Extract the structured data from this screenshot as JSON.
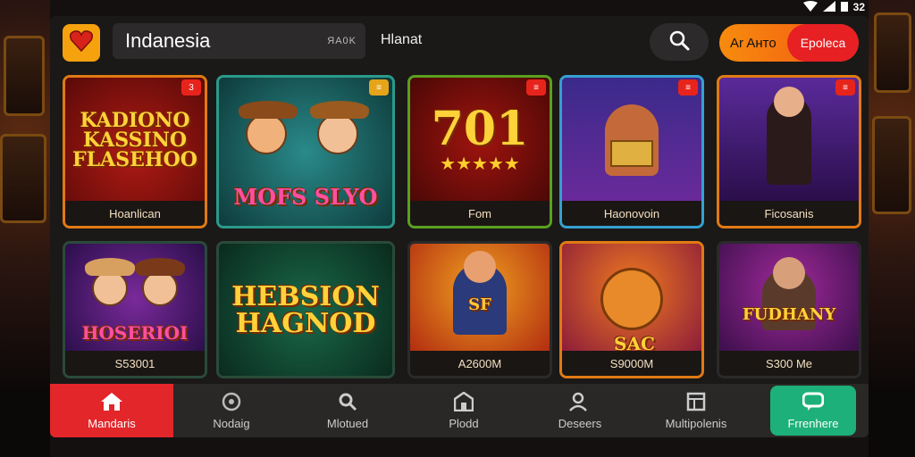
{
  "status_bar": {
    "time": "32",
    "icons": [
      "wifi-icon",
      "signal-icon",
      "battery-icon"
    ]
  },
  "header": {
    "logo_icon": "heart-icon",
    "search_title": "Indanesia",
    "search_tag": "ЯA0K",
    "nav_label": "Hlanat",
    "search_icon": "search-icon",
    "cta_left": "Ar Aнто",
    "cta_right": "Epoleca"
  },
  "games": [
    {
      "art_title": "KADIONO\nKASSINO\nFLASEHOO",
      "caption": "Hoanlican",
      "badge": "3"
    },
    {
      "art_title": "MOFS SLYO",
      "caption": "",
      "badge": ""
    },
    {
      "art_title": "701",
      "caption": "Fom",
      "badge": ""
    },
    {
      "art_title": "",
      "caption": "Haonovoin",
      "badge": ""
    },
    {
      "art_title": "",
      "caption": "Ficosanis",
      "badge": ""
    },
    {
      "art_title": "HOSERIOI",
      "caption": "S53001",
      "badge": ""
    },
    {
      "art_title": "HEBSION\nHAGNOD",
      "caption": "",
      "badge": ""
    },
    {
      "art_title": "SF",
      "caption": "A2600M",
      "badge": ""
    },
    {
      "art_title": "SAC",
      "caption": "S9000M",
      "badge": ""
    },
    {
      "art_title": "FUDHANY",
      "caption": "S300 Me",
      "badge": ""
    }
  ],
  "bottom_nav": [
    {
      "label": "Mandaris",
      "icon": "home-icon"
    },
    {
      "label": "Nodaig",
      "icon": "shield-icon"
    },
    {
      "label": "Mlotued",
      "icon": "search-icon"
    },
    {
      "label": "Plodd",
      "icon": "store-icon"
    },
    {
      "label": "Deseers",
      "icon": "user-icon"
    },
    {
      "label": "Multipolenis",
      "icon": "table-icon"
    },
    {
      "label": "Frrenhere",
      "icon": "chat-icon"
    }
  ]
}
